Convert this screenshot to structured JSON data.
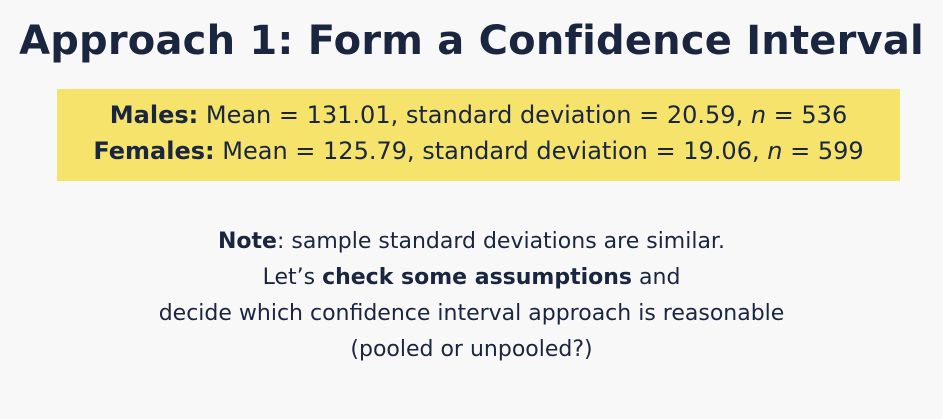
{
  "slide": {
    "title": "Approach 1: Form a Confidence Interval",
    "stats": {
      "males": {
        "label": "Males:",
        "text_before_n": " Mean = 131.01, standard deviation = 20.59, ",
        "n_symbol": "n",
        "text_after_n": " = 536"
      },
      "females": {
        "label": "Females:",
        "text_before_n": " Mean = 125.79, standard deviation = 19.06, ",
        "n_symbol": "n",
        "text_after_n": " = 599"
      }
    },
    "note": {
      "label": "Note",
      "text": ": sample standard deviations are similar."
    },
    "assumptions": {
      "line1_prefix": "Let’s ",
      "line1_bold": "check some assumptions",
      "line1_suffix": " and",
      "line2": "decide which confidence interval approach is reasonable",
      "line3": "(pooled or unpooled?)"
    },
    "colors": {
      "highlight": "#f5e36c",
      "text": "#1a2540",
      "background": "#f8f8f8"
    }
  }
}
